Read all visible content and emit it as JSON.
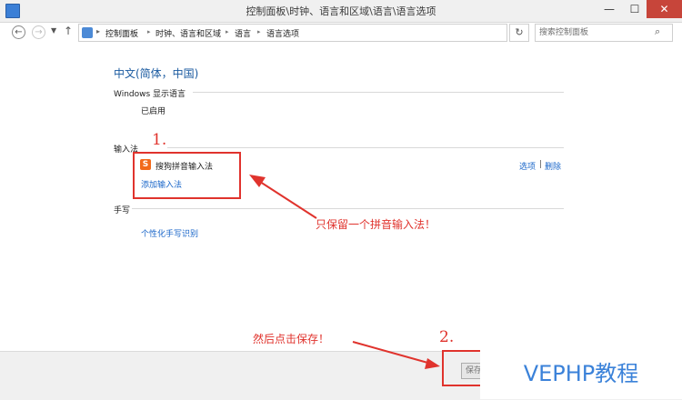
{
  "window": {
    "title": "控制面板\\时钟、语言和区域\\语言\\语言选项",
    "min_label": "—",
    "max_label": "☐",
    "close_label": "✕"
  },
  "nav": {
    "back_glyph": "←",
    "forward_glyph": "→",
    "up_glyph": "↑",
    "breadcrumbs": [
      "控制面板",
      "时钟、语言和区域",
      "语言",
      "语言选项"
    ],
    "search_placeholder": "搜索控制面板"
  },
  "content": {
    "language_title": "中文(简体，中国)",
    "display_language_heading": "Windows 显示语言",
    "display_language_status": "已启用",
    "input_method_heading": "输入法",
    "input_method": {
      "icon_letter": "S",
      "name": "搜狗拼音输入法",
      "options_link": "选项",
      "separator": "|",
      "remove_link": "删除"
    },
    "add_input_method_link": "添加输入法",
    "handwriting_heading": "手写",
    "handwriting_link": "个性化手写识别"
  },
  "annotations": {
    "step1_number": "1.",
    "step1_text": "只保留一个拼音输入法！",
    "step2_number": "2.",
    "step2_text": "然后点击保存！"
  },
  "footer": {
    "save_button_label": "保存",
    "watermark": "VEPHP教程"
  },
  "colors": {
    "annotation_red": "#e0332d",
    "link_blue": "#1a66c9",
    "title_blue": "#1a5aa0",
    "watermark_blue": "#3b82d9",
    "ime_orange": "#f26a1b"
  }
}
